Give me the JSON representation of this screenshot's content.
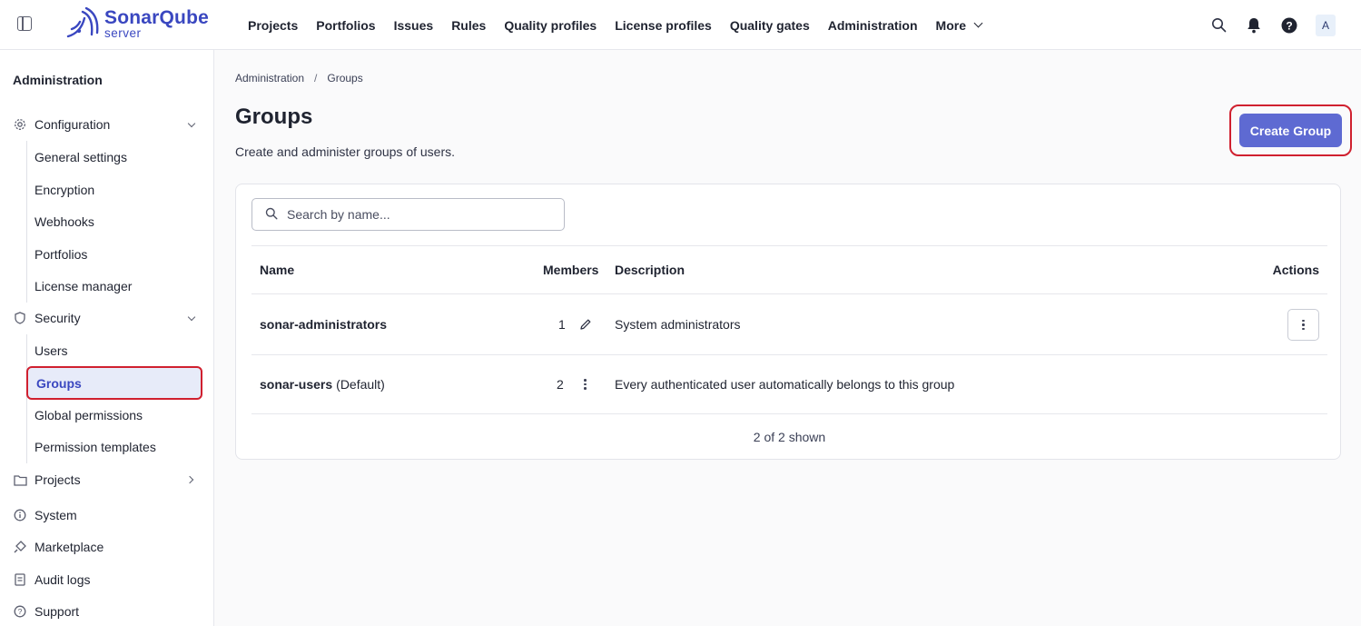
{
  "brand": {
    "name": "SonarQube",
    "edition": "server",
    "color": "#3a47c0"
  },
  "nav": {
    "items": [
      "Projects",
      "Portfolios",
      "Issues",
      "Rules",
      "Quality profiles",
      "License profiles",
      "Quality gates",
      "Administration"
    ],
    "more": "More"
  },
  "top_icons": [
    "search-icon",
    "bell-icon",
    "help-icon"
  ],
  "avatar": "A",
  "sidebar": {
    "title": "Administration",
    "configuration": {
      "label": "Configuration",
      "items": [
        "General settings",
        "Encryption",
        "Webhooks",
        "Portfolios",
        "License manager"
      ]
    },
    "security": {
      "label": "Security",
      "items": [
        "Users",
        "Groups",
        "Global permissions",
        "Permission templates"
      ]
    },
    "projects": "Projects",
    "system": "System",
    "marketplace": "Marketplace",
    "audit_logs": "Audit logs",
    "support": "Support"
  },
  "breadcrumb": {
    "root": "Administration",
    "separator": "/",
    "current": "Groups"
  },
  "page": {
    "title": "Groups",
    "description": "Create and administer groups of users.",
    "create_button": "Create Group",
    "accent": "#5e6ad2",
    "highlight": "#d0202f"
  },
  "search": {
    "placeholder": "Search by name..."
  },
  "table": {
    "headers": {
      "name": "Name",
      "members": "Members",
      "description": "Description",
      "actions": "Actions"
    },
    "rows": [
      {
        "name": "sonar-administrators",
        "suffix": "",
        "members": "1",
        "description": "System administrators"
      },
      {
        "name": "sonar-users",
        "suffix": "(Default)",
        "members": "2",
        "description": "Every authenticated user automatically belongs to this group"
      }
    ],
    "footer": "2 of 2 shown"
  }
}
